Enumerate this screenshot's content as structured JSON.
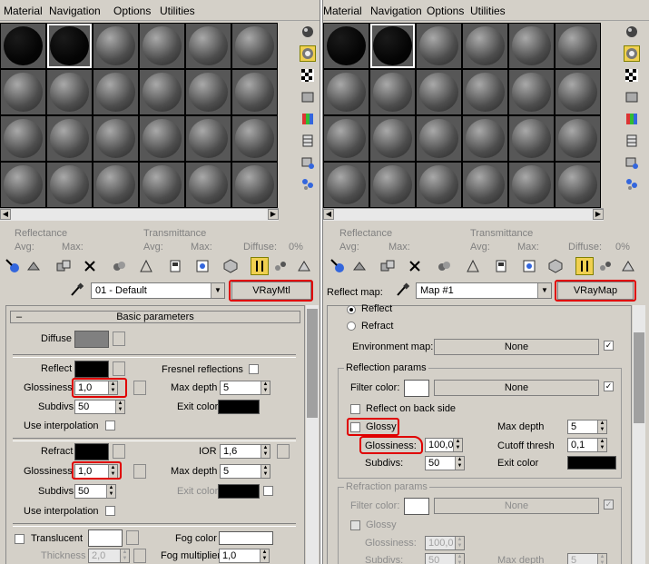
{
  "menus": [
    "Material",
    "Navigation",
    "Options",
    "Utilities"
  ],
  "left": {
    "info": {
      "reflectance": "Reflectance",
      "avg": "Avg:",
      "max": "Max:",
      "transmittance": "Transmittance",
      "avg2": "Avg:",
      "max2": "Max:",
      "diffuse": "Diffuse:",
      "diffuse_value": "0%"
    },
    "material_name": "01 - Default",
    "type_button": "VRayMtl",
    "basic_title": "Basic parameters",
    "basic_collapse": "–",
    "diffuse_label": "Diffuse",
    "reflect": {
      "label": "Reflect",
      "glossiness_label": "Glossiness",
      "glossiness_value": "1,0",
      "subdivs_label": "Subdivs",
      "subdivs_value": "50",
      "interp_label": "Use interpolation",
      "fresnel_label": "Fresnel reflections",
      "max_depth_label": "Max depth",
      "max_depth_value": "5",
      "exit_color_label": "Exit color"
    },
    "refract": {
      "label": "Refract",
      "ior_label": "IOR",
      "ior_value": "1,6",
      "glossiness_label": "Glossiness",
      "glossiness_value": "1,0",
      "max_depth_label": "Max depth",
      "max_depth_value": "5",
      "subdivs_label": "Subdivs",
      "subdivs_value": "50",
      "exit_color_label": "Exit color",
      "interp_label": "Use interpolation"
    },
    "translucent": {
      "label": "Translucent",
      "fog_color_label": "Fog color",
      "thickness_label": "Thickness",
      "thickness_value": "2,0",
      "fog_mult_label": "Fog multiplier",
      "fog_mult_value": "1,0"
    }
  },
  "right": {
    "info": {
      "reflectance": "Reflectance",
      "avg": "Avg:",
      "max": "Max:",
      "transmittance": "Transmittance",
      "avg2": "Avg:",
      "max2": "Max:",
      "diffuse": "Diffuse:",
      "diffuse_value": "0%"
    },
    "map_label": "Reflect map:",
    "map_name": "Map #1",
    "type_button": "VRayMap",
    "reflect_radio": "Reflect",
    "refract_radio": "Refract",
    "env_map_label": "Environment map:",
    "env_map_value": "None",
    "reflection_params": {
      "title": "Reflection params",
      "filter_color_label": "Filter color:",
      "filter_map_value": "None",
      "back_side_label": "Reflect on back side",
      "glossy_label": "Glossy",
      "glossiness_label": "Glossiness:",
      "glossiness_value": "100,0",
      "subdivs_label": "Subdivs:",
      "subdivs_value": "50",
      "max_depth_label": "Max depth",
      "max_depth_value": "5",
      "cutoff_label": "Cutoff thresh",
      "cutoff_value": "0,1",
      "exit_color_label": "Exit color"
    },
    "refraction_params": {
      "title": "Refraction params",
      "filter_color_label": "Filter color:",
      "filter_map_value": "None",
      "glossy_label": "Glossy",
      "glossiness_label": "Glossiness:",
      "glossiness_value": "100,0",
      "subdivs_label": "Subdivs:",
      "subdivs_value": "50",
      "max_depth_label": "Max depth",
      "max_depth_value": "5"
    }
  },
  "colors": {
    "highlight_red": "#e00000",
    "active_tool": "#f0d050",
    "diffuse_swatch": "#808080"
  }
}
